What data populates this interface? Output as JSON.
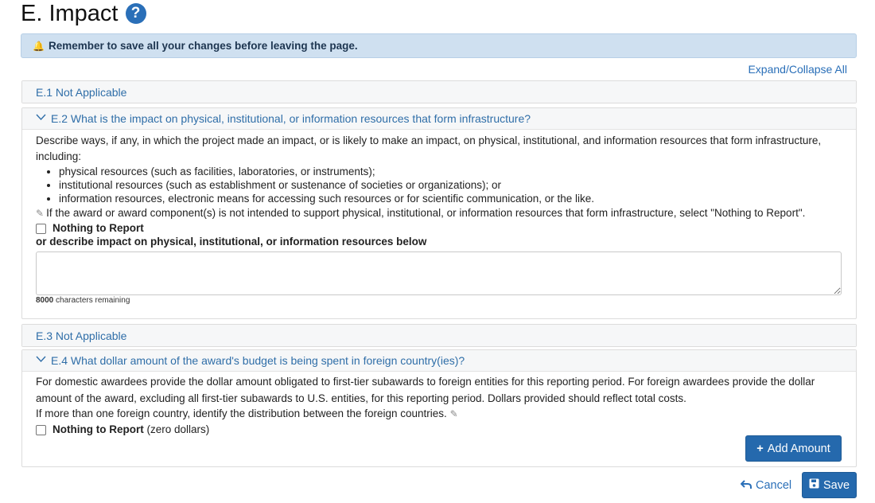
{
  "page": {
    "title": "E. Impact",
    "help_icon_glyph": "?"
  },
  "alert": {
    "icon": "bell-icon",
    "text": "Remember to save all your changes before leaving the page."
  },
  "expand_collapse_label": "Expand/Collapse All",
  "sections": {
    "e1": {
      "header": "E.1 Not Applicable"
    },
    "e2": {
      "header": "E.2 What is the impact on physical, institutional, or information resources that form infrastructure?",
      "intro": "Describe ways, if any, in which the project made an impact, or is likely to make an impact, on physical, institutional, and information resources that form infrastructure, including:",
      "bullets": [
        "physical resources (such as facilities, laboratories, or instruments);",
        "institutional resources (such as establishment or sustenance of societies or organizations); or",
        "information resources, electronic means for accessing such resources or for scientific communication, or the like."
      ],
      "note": "If the award or award component(s) is not intended to support physical, institutional, or information resources that form infrastructure, select \"Nothing to Report\".",
      "nothing_label": "Nothing to Report",
      "describe_label": "or describe impact on physical, institutional, or information resources below",
      "textarea_value": "",
      "chars_count": "8000",
      "chars_suffix": " characters remaining"
    },
    "e3": {
      "header": "E.3 Not Applicable"
    },
    "e4": {
      "header": "E.4 What dollar amount of the award's budget is being spent in foreign country(ies)?",
      "para1": "For domestic awardees provide the dollar amount obligated to first-tier subawards to foreign entities for this reporting period. For foreign awardees provide the dollar amount of the award, excluding all first-tier subawards to U.S. entities, for this reporting period. Dollars provided should reflect total costs.",
      "para2": "If more than one foreign country, identify the distribution between the foreign countries.",
      "nothing_label": "Nothing to Report",
      "nothing_suffix": " (zero dollars)",
      "add_amount_label": "Add Amount"
    }
  },
  "footer": {
    "cancel_label": "Cancel",
    "save_label": "Save"
  },
  "colors": {
    "primary": "#2569ad",
    "link": "#2a6fb8",
    "alert_bg": "#cfe0f0"
  }
}
